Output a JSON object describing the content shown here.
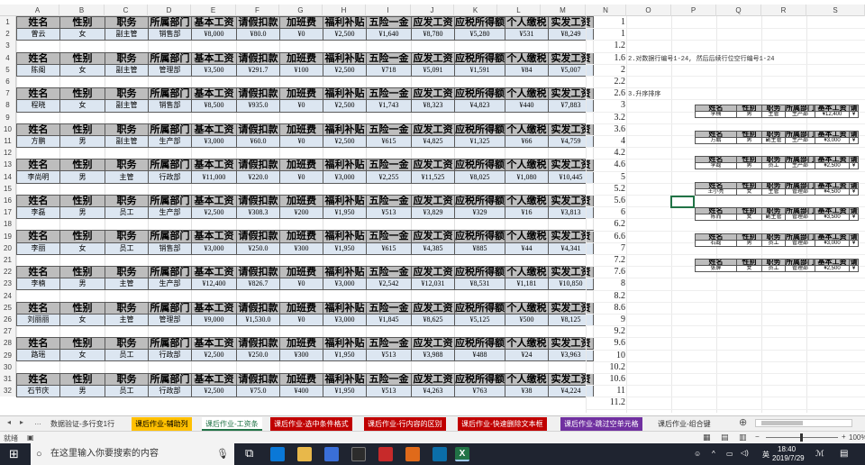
{
  "columns": [
    "A",
    "B",
    "C",
    "D",
    "E",
    "F",
    "G",
    "H",
    "I",
    "J",
    "K",
    "L",
    "M",
    "N",
    "O",
    "P",
    "Q",
    "R",
    "S"
  ],
  "table": {
    "headers": [
      "姓名",
      "性别",
      "职务",
      "所属部门",
      "基本工资",
      "请假扣款",
      "加班费",
      "福利补贴",
      "五险一金",
      "应发工资",
      "应税所得额",
      "个人缴税",
      "实发工资"
    ],
    "records": [
      [
        "曾云",
        "女",
        "副主管",
        "销售部",
        "¥8,000",
        "¥80.0",
        "¥0",
        "¥2,500",
        "¥1,640",
        "¥8,780",
        "¥5,280",
        "¥531",
        "¥8,249"
      ],
      [
        "陈阁",
        "女",
        "副主管",
        "管理部",
        "¥3,500",
        "¥291.7",
        "¥100",
        "¥2,500",
        "¥718",
        "¥5,091",
        "¥1,591",
        "¥84",
        "¥5,007"
      ],
      [
        "程晓",
        "女",
        "副主管",
        "销售部",
        "¥8,500",
        "¥935.0",
        "¥0",
        "¥2,500",
        "¥1,743",
        "¥8,323",
        "¥4,823",
        "¥440",
        "¥7,883"
      ],
      [
        "方鹏",
        "男",
        "副主管",
        "生产部",
        "¥3,000",
        "¥60.0",
        "¥0",
        "¥2,500",
        "¥615",
        "¥4,825",
        "¥1,325",
        "¥66",
        "¥4,759"
      ],
      [
        "李尚明",
        "男",
        "主管",
        "行政部",
        "¥11,000",
        "¥220.0",
        "¥0",
        "¥3,000",
        "¥2,255",
        "¥11,525",
        "¥8,025",
        "¥1,080",
        "¥10,445"
      ],
      [
        "李磊",
        "男",
        "员工",
        "生产部",
        "¥2,500",
        "¥308.3",
        "¥200",
        "¥1,950",
        "¥513",
        "¥3,829",
        "¥329",
        "¥16",
        "¥3,813"
      ],
      [
        "李丽",
        "女",
        "员工",
        "销售部",
        "¥3,000",
        "¥250.0",
        "¥300",
        "¥1,950",
        "¥615",
        "¥4,385",
        "¥885",
        "¥44",
        "¥4,341"
      ],
      [
        "李楠",
        "男",
        "主管",
        "生产部",
        "¥12,400",
        "¥826.7",
        "¥0",
        "¥3,000",
        "¥2,542",
        "¥12,031",
        "¥8,531",
        "¥1,181",
        "¥10,850"
      ],
      [
        "刘丽丽",
        "女",
        "主管",
        "管理部",
        "¥9,000",
        "¥1,530.0",
        "¥0",
        "¥3,000",
        "¥1,845",
        "¥8,625",
        "¥5,125",
        "¥500",
        "¥8,125"
      ],
      [
        "路瑶",
        "女",
        "员工",
        "行政部",
        "¥2,500",
        "¥250.0",
        "¥300",
        "¥1,950",
        "¥513",
        "¥3,988",
        "¥488",
        "¥24",
        "¥3,963"
      ],
      [
        "石节庆",
        "男",
        "员工",
        "行政部",
        "¥2,500",
        "¥75.0",
        "¥400",
        "¥1,950",
        "¥513",
        "¥4,263",
        "¥763",
        "¥38",
        "¥4,224"
      ]
    ]
  },
  "n_values": [
    "1",
    "1",
    "1.2",
    "1.6",
    "2",
    "2.2",
    "2.6",
    "3",
    "3.2",
    "3.6",
    "4",
    "4.2",
    "4.6",
    "5",
    "5.2",
    "5.6",
    "6",
    "6.2",
    "6.6",
    "7",
    "7.2",
    "7.6",
    "8",
    "8.2",
    "8.6",
    "9",
    "9.2",
    "9.6",
    "10",
    "10.2",
    "10.6",
    "11",
    "11.2"
  ],
  "notes": [
    "2.对数据行编号1-24, 然后后续行位空行编号1-24",
    "3.升序排序"
  ],
  "mini_table": {
    "headers": [
      "姓名",
      "性别",
      "职务",
      "所属部门",
      "基本工资",
      "请"
    ],
    "records": [
      [
        "李楠",
        "男",
        "主管",
        "生产部",
        "¥12,400",
        "¥"
      ],
      [
        "方鹏",
        "男",
        "副主管",
        "生产部",
        "¥3,000",
        "¥"
      ],
      [
        "李磊",
        "男",
        "员工",
        "生产部",
        "¥2,500",
        "¥"
      ],
      [
        "王小亮",
        "女",
        "主管",
        "管理部",
        "¥4,500",
        "¥"
      ],
      [
        "陈而",
        "女",
        "副主管",
        "管理部",
        "¥3,500",
        "¥"
      ],
      [
        "石磊",
        "男",
        "员工",
        "管理部",
        "¥3,000",
        "¥"
      ],
      [
        "张屏",
        "女",
        "员工",
        "管理部",
        "¥2,500",
        "¥"
      ]
    ]
  },
  "tabs": [
    {
      "label": "数据验证-多行变1行",
      "bg": "#f0f0f0",
      "color": "#333"
    },
    {
      "label": "课后作业-辅助列",
      "bg": "#ffc000",
      "color": "#000"
    },
    {
      "label": "课后作业-工资条",
      "bg": "#ffffff",
      "color": "#217346"
    },
    {
      "label": "课后作业-选中条件格式",
      "bg": "#c00000",
      "color": "#fff"
    },
    {
      "label": "课后作业-行内容的区别",
      "bg": "#c00000",
      "color": "#fff"
    },
    {
      "label": "课后作业-快速删除文本框",
      "bg": "#c00000",
      "color": "#fff"
    },
    {
      "label": "课后作业-跳过空单元格",
      "bg": "#7030a0",
      "color": "#fff"
    },
    {
      "label": "课后作业-组合键",
      "bg": "#f0f0f0",
      "color": "#333"
    }
  ],
  "status": {
    "ready": "就绪",
    "zoom": "100%"
  },
  "taskbar": {
    "search_placeholder": "在这里输入你要搜索的内容",
    "lang": "英",
    "time": "18:40",
    "date": "2019/7/29"
  }
}
